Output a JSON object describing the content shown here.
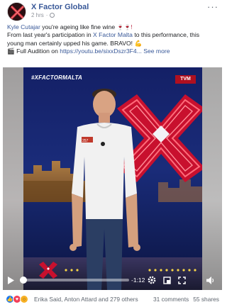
{
  "post": {
    "page_name": "X Factor Global",
    "time": "2 hrs",
    "globe_icon": "globe-icon",
    "more_label": "···"
  },
  "text": {
    "line1_link": "Kyle Cutajar",
    "line1_text": " you're ageing like fine wine ",
    "line1_glyph": "🍷🍷!",
    "line2_prefix": "From last year's participation in ",
    "line2_link": "X Factor Malta",
    "line2_suffix": " to this performance, this",
    "line3_text": "young man certainly upped his game. BRAVO! ",
    "line3_glyph": "💪",
    "line4_icon": "🎬",
    "line4_prefix": " Full Audition on ",
    "line4_link": "https://youtu.be/sixxDszr3F4",
    "line4_ellipsis": "...",
    "see_more": "See more"
  },
  "video": {
    "watermark": "#XFACTORMALTA",
    "channel_badge": "TVM",
    "progress_fraction": 0.03,
    "time_remaining": "-1:12",
    "controls": [
      "play-icon",
      "settings-icon",
      "fullscreen-exit-icon",
      "expand-icon",
      "volume-icon"
    ]
  },
  "footer": {
    "reaction_names": "Erika Said, Anton Attard and 279 others",
    "comments": "31 comments",
    "shares": "55 shares",
    "reaction_types": [
      "like",
      "love",
      "wow"
    ]
  },
  "colors": {
    "link": "#385898",
    "stage_background": "#101b4b",
    "xfactor_red": "#c8102e",
    "like": "#1877f2",
    "love": "#f33e58",
    "wow": "#f7b125"
  }
}
